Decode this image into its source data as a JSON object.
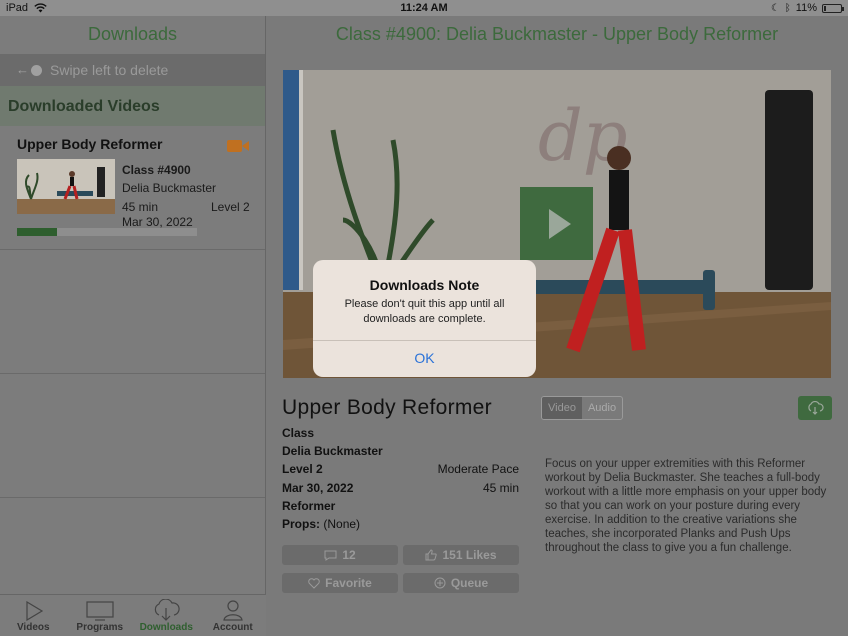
{
  "status_bar": {
    "device": "iPad",
    "time": "11:24 AM",
    "battery": "11%",
    "battery_level": 0.11
  },
  "sidebar": {
    "title": "Downloads",
    "swipe_hint": "Swipe left to delete",
    "section_header": "Downloaded Videos",
    "items": [
      {
        "title": "Upper Body Reformer",
        "class_number": "Class #4900",
        "instructor": "Delia Buckmaster",
        "duration": "45 min",
        "level": "Level 2",
        "date": "Mar 30, 2022",
        "progress": 0.22
      }
    ]
  },
  "tabs": [
    {
      "label": "Videos",
      "icon": "play-icon",
      "active": false
    },
    {
      "label": "Programs",
      "icon": "tv-icon",
      "active": false
    },
    {
      "label": "Downloads",
      "icon": "cloud-download-icon",
      "active": true
    },
    {
      "label": "Account",
      "icon": "person-icon",
      "active": false
    }
  ],
  "main": {
    "title": "Class #4900: Delia Buckmaster - Upper Body Reformer",
    "class_name": "Upper Body Reformer",
    "type_label": "Class",
    "instructor": "Delia Buckmaster",
    "level": "Level 2",
    "pace": "Moderate Pace",
    "date": "Mar 30, 2022",
    "duration": "45 min",
    "equipment": "Reformer",
    "props_label": "Props:",
    "props_value": "(None)",
    "media_toggle": {
      "video": "Video",
      "audio": "Audio",
      "selected": "Video"
    },
    "description": "Focus on your upper extremities with this Reformer workout by Delia Buckmaster. She teaches a full-body workout with a little more emphasis on your upper body so that you can work on your posture during every exercise. In addition to the creative variations she teaches, she incorporated Planks and Push Ups throughout the class to give you a fun challenge.",
    "comments_count": "12",
    "likes_label": "151 Likes",
    "favorite_label": "Favorite",
    "queue_label": "Queue"
  },
  "dialog": {
    "title": "Downloads Note",
    "message": "Please don't quit this app until all downloads are complete.",
    "ok_label": "OK"
  },
  "colors": {
    "brand_green": "#3c6a3c",
    "dialog_link": "#2a72d8",
    "camera_orange": "#c07020"
  }
}
